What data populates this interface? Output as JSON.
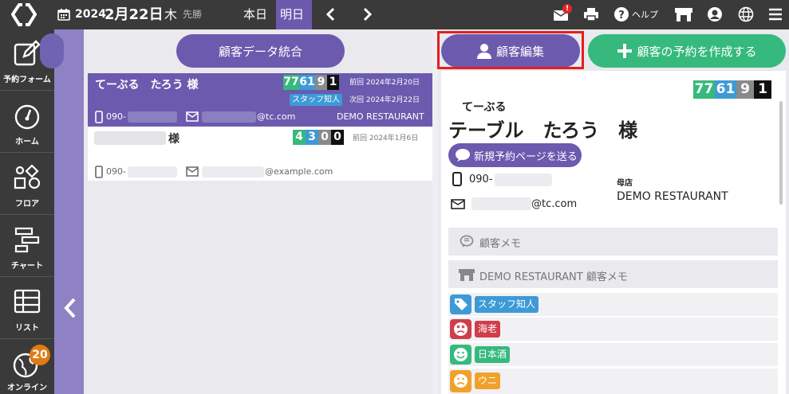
{
  "topbar": {
    "year": "2024",
    "date": "2月22日",
    "weekday": "木",
    "rokuyo": "先勝",
    "tab_today": "本日",
    "tab_tomorrow": "明日",
    "mail_badge": "!",
    "help": "ヘルプ"
  },
  "sidebar": {
    "items": [
      {
        "label": "予約フォーム",
        "icon": "pen-square-icon"
      },
      {
        "label": "ホーム",
        "icon": "gauge-icon"
      },
      {
        "label": "フロア",
        "icon": "shapes-icon"
      },
      {
        "label": "チャート",
        "icon": "gantt-icon"
      },
      {
        "label": "リスト",
        "icon": "table-icon"
      },
      {
        "label": "オンライン",
        "icon": "globe-icon",
        "badge": "20"
      }
    ]
  },
  "merge_button": "顧客データ統合",
  "edit_button": "顧客編集",
  "create_button": "顧客の予約を作成する",
  "results": [
    {
      "name": "てーぶる　たろう 様",
      "counts": [
        "77",
        "61",
        "9",
        "1"
      ],
      "prev_visit": "前回 2024年2月20日",
      "next_visit": "次回 2024年2月22日",
      "tag": "スタッフ知人",
      "phone": "090-",
      "email": "@tc.com",
      "store": "DEMO RESTAURANT"
    },
    {
      "name": "様",
      "counts": [
        "4",
        "3",
        "0",
        "0"
      ],
      "prev_visit": "前回 2024年1月6日",
      "phone": "090-",
      "email": "@example.com"
    }
  ],
  "detail": {
    "counts": [
      "77",
      "61",
      "9",
      "1"
    ],
    "furigana": "てーぶる",
    "name": "テーブル　たろう　様",
    "send_button": "新規予約ページを送る",
    "phone": "090-",
    "email": "@tc.com",
    "home_store_label": "母店",
    "home_store": "DEMO RESTAURANT",
    "memo": "顧客メモ",
    "store_memo": "DEMO RESTAURANT 顧客メモ",
    "tags": [
      {
        "label": "スタッフ知人",
        "color": "#3d9ad6",
        "icon": "tag-icon"
      },
      {
        "label": "海老",
        "color": "#cf3e4a",
        "icon": "angry-face-icon"
      },
      {
        "label": "日本酒",
        "color": "#36b97c",
        "icon": "smile-face-icon"
      },
      {
        "label": "ウニ",
        "color": "#f0a12c",
        "icon": "sad-face-icon"
      }
    ]
  },
  "colors": {
    "purple": "#6b5aae",
    "green": "#36b97c",
    "blue": "#3d9ad6",
    "gray": "#8a8a8a",
    "black": "#111111",
    "red": "#cf3e4a",
    "orange": "#f0a12c",
    "topbar": "#3a3a3a"
  }
}
